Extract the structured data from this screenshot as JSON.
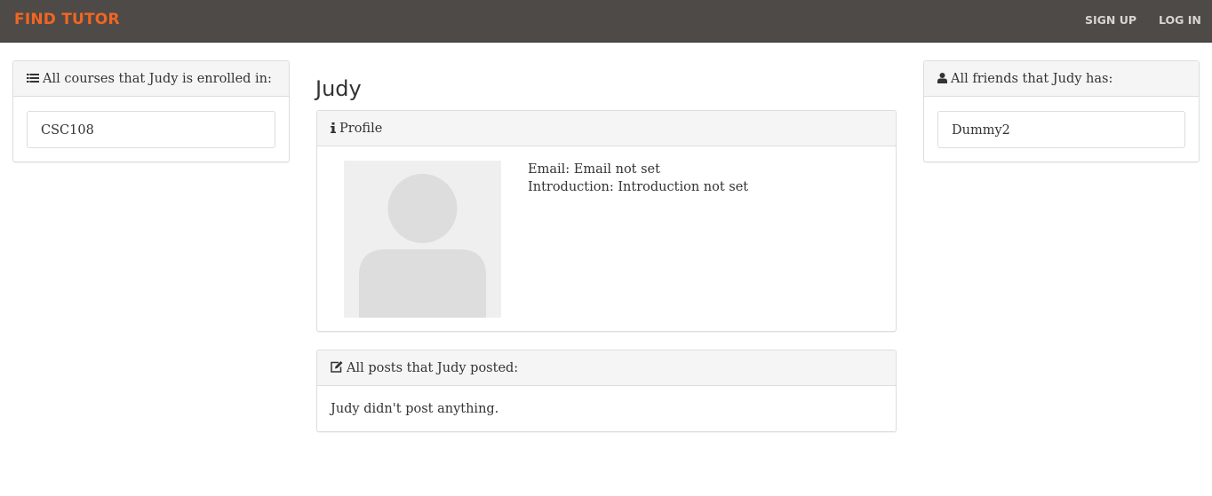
{
  "navbar": {
    "brand": "FIND TUTOR",
    "sign_up": "SIGN UP",
    "log_in": "LOG IN",
    "brand_color": "#f26522",
    "background_color": "#4e4a47"
  },
  "courses_panel": {
    "icon": "list-icon",
    "heading": "All courses that Judy is enrolled in:",
    "items": [
      "CSC108"
    ]
  },
  "user": {
    "name": "Judy"
  },
  "profile_panel": {
    "icon": "info-icon",
    "heading": "Profile",
    "avatar_icon": "avatar-placeholder-icon",
    "email_line": "Email: Email not set",
    "intro_line": "Introduction: Introduction not set"
  },
  "posts_panel": {
    "icon": "edit-icon",
    "heading": "All posts that Judy posted:",
    "empty_text": "Judy didn't post anything."
  },
  "friends_panel": {
    "icon": "user-icon",
    "heading": "All friends that Judy has:",
    "items": [
      "Dummy2"
    ]
  }
}
